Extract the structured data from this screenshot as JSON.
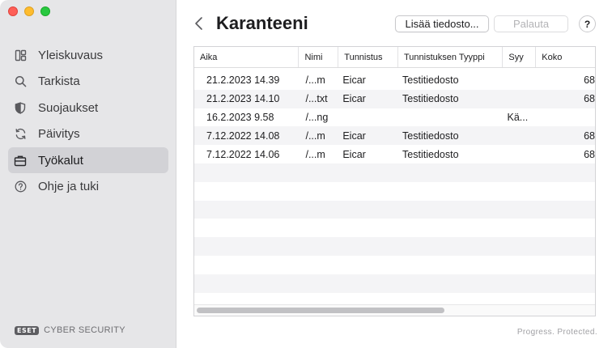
{
  "sidebar": {
    "items": [
      {
        "label": "Yleiskuvaus",
        "icon": "dashboard-icon"
      },
      {
        "label": "Tarkista",
        "icon": "search-icon"
      },
      {
        "label": "Suojaukset",
        "icon": "shield-icon"
      },
      {
        "label": "Päivitys",
        "icon": "refresh-icon"
      },
      {
        "label": "Työkalut",
        "icon": "briefcase-icon",
        "active": true
      },
      {
        "label": "Ohje ja tuki",
        "icon": "help-circle-icon"
      }
    ],
    "brand_logo": "ESET",
    "brand_text": "CYBER SECURITY"
  },
  "header": {
    "title": "Karanteeni",
    "add_file_label": "Lisää tiedosto...",
    "restore_label": "Palauta",
    "help_label": "?"
  },
  "table": {
    "columns": [
      "Aika",
      "Nimi",
      "Tunnistus",
      "Tunnistuksen Tyyppi",
      "Syy",
      "Koko"
    ],
    "rows": [
      {
        "aika": "21.2.2023 14.39",
        "nimi": "/...m",
        "tunnistus": "Eicar",
        "tyyppi": "Testitiedosto",
        "syy": "",
        "koko": "68"
      },
      {
        "aika": "21.2.2023 14.10",
        "nimi": "/...txt",
        "tunnistus": "Eicar",
        "tyyppi": "Testitiedosto",
        "syy": "",
        "koko": "68"
      },
      {
        "aika": "16.2.2023 9.58",
        "nimi": "/...ng",
        "tunnistus": "",
        "tyyppi": "",
        "syy": "Kä...",
        "koko": ""
      },
      {
        "aika": "7.12.2022 14.08",
        "nimi": "/...m",
        "tunnistus": "Eicar",
        "tyyppi": "Testitiedosto",
        "syy": "",
        "koko": "68"
      },
      {
        "aika": "7.12.2022 14.06",
        "nimi": "/...m",
        "tunnistus": "Eicar",
        "tyyppi": "Testitiedosto",
        "syy": "",
        "koko": "68"
      }
    ]
  },
  "footer": {
    "tagline": "Progress. Protected."
  }
}
